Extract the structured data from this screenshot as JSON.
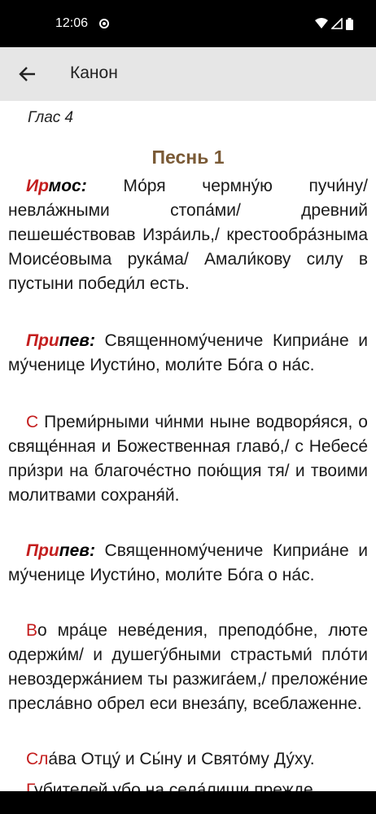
{
  "status": {
    "time": "12:06"
  },
  "app_bar": {
    "title": "Канон"
  },
  "content": {
    "glas": "Глас 4",
    "song_title": "Песнь 1",
    "paragraphs": [
      {
        "red_initial": "Ир",
        "label_rest": "мос:",
        "text": " Мо́ря чермну́ю пучи́ну/ невла́жными стопа́ми/ древний пешеше́ствовав Изра́иль,/ крестообра́зныма Моисе́овыма рука́ма/ Амали́кову силу в пустыни победи́л есть."
      },
      {
        "red_initial": "При",
        "label_rest": "пев:",
        "text": " Священному́чениче Киприа́не и му́ченице Иусти́но, моли́те Бо́га о на́с."
      },
      {
        "red_initial": "С",
        "label_rest": "",
        "text": " Преми́рными чи́нми ныне водворя́яся, о свяще́нная и Божественная главо́,/ с Небесе́ при́зри на благоче́стно пою́щия тя/ и твоими молитвами сохраня́й."
      },
      {
        "red_initial": "При",
        "label_rest": "пев:",
        "text": " Священному́чениче Киприа́не и му́ченице Иусти́но, моли́те Бо́га о на́с."
      },
      {
        "red_initial": "В",
        "label_rest": "",
        "text": "о мра́це неве́дения, преподо́бне, люте одержи́м/ и душегу́бными страстьми́ пло́ти невоздержа́нием ты разжига́ем,/ преложе́ние пресла́вно обрел еси внеза́пу, всеблаженне."
      },
      {
        "red_initial": "Сл",
        "label_rest": "",
        "text": "а́ва Отцу́ и Сы́ну и Свято́му Ду́ху."
      },
      {
        "red_initial": "Г",
        "label_rest": "",
        "text": "убителей убо на седа́лищи прежде"
      }
    ]
  }
}
